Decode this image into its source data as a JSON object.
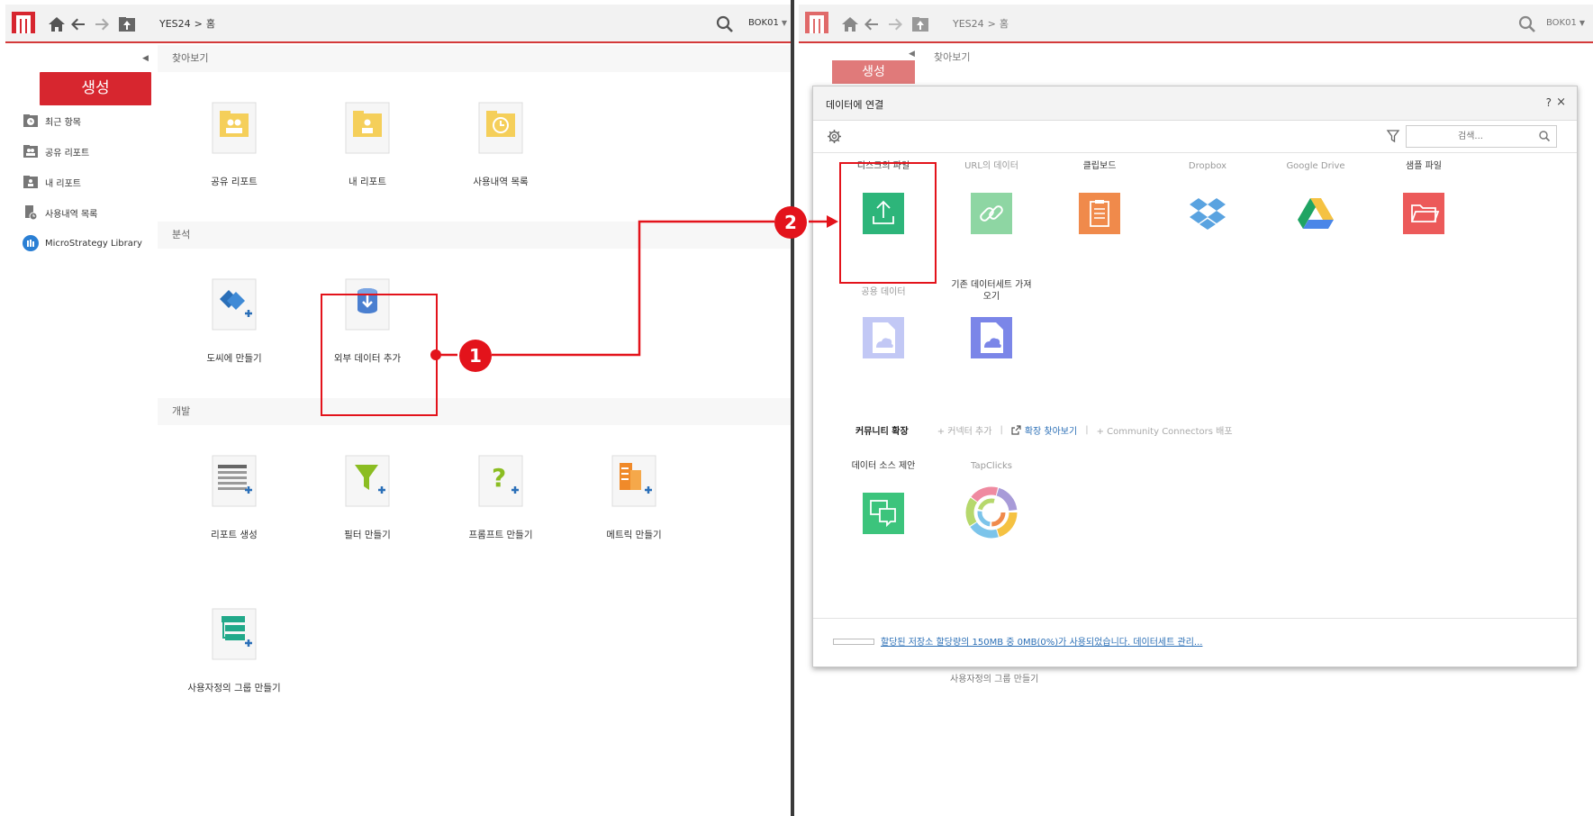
{
  "colors": {
    "accent_red": "#d7262f",
    "annotation_red": "#e3131b",
    "link_blue": "#2b6fb6"
  },
  "left": {
    "breadcrumb": [
      "YES24",
      ">",
      "홈"
    ],
    "user": "BOK01",
    "sidebar": {
      "create_label": "생성",
      "items": [
        {
          "icon": "clock-folder-icon",
          "label": "최근 항목"
        },
        {
          "icon": "shared-folder-icon",
          "label": "공유 리포트"
        },
        {
          "icon": "my-folder-icon",
          "label": "내 리포트"
        },
        {
          "icon": "history-icon",
          "label": "사용내역 목록"
        },
        {
          "icon": "library-icon",
          "label": "MicroStrategy Library"
        }
      ]
    },
    "sections": {
      "browse": {
        "header": "찾아보기",
        "tiles": [
          {
            "icon": "shared-reports-icon",
            "label": "공유 리포트"
          },
          {
            "icon": "my-reports-icon",
            "label": "내 리포트"
          },
          {
            "icon": "history-list-icon",
            "label": "사용내역 목록"
          }
        ]
      },
      "analysis": {
        "header": "분석",
        "tiles": [
          {
            "icon": "dossier-icon",
            "label": "도씨에 만들기"
          },
          {
            "icon": "add-external-data-icon",
            "label": "외부 데이터 추가"
          }
        ]
      },
      "development": {
        "header": "개발",
        "tiles": [
          {
            "icon": "report-create-icon",
            "label": "리포트 생성"
          },
          {
            "icon": "filter-create-icon",
            "label": "필터 만들기"
          },
          {
            "icon": "prompt-create-icon",
            "label": "프롬프트 만들기"
          },
          {
            "icon": "metric-create-icon",
            "label": "메트릭 만들기"
          },
          {
            "icon": "custom-group-icon",
            "label": "사용자정의 그룹 만들기"
          }
        ]
      }
    }
  },
  "right": {
    "breadcrumb": [
      "YES24",
      ">",
      "홈"
    ],
    "user": "BOK01",
    "bg": {
      "browse_header": "찾아보기",
      "create_label": "생성",
      "custom_group_label": "사용자정의 그룹 만들기"
    },
    "modal": {
      "title": "데이터에 연결",
      "help": "?",
      "close": "×",
      "search_placeholder": "검색...",
      "sources_row1": [
        {
          "label": "디스크의 파일",
          "icon": "upload-file-icon",
          "color": "#2db57a",
          "dim": false
        },
        {
          "label": "URL의 데이터",
          "icon": "link-icon",
          "color": "#8ed6a3",
          "dim": true
        },
        {
          "label": "클립보드",
          "icon": "clipboard-icon",
          "color": "#f08a4b",
          "dim": false
        },
        {
          "label": "Dropbox",
          "icon": "dropbox-icon",
          "color": "#5aa3e0",
          "dim": true
        },
        {
          "label": "Google Drive",
          "icon": "google-drive-icon",
          "color": "#f5c242",
          "dim": true
        },
        {
          "label": "샘플 파일",
          "icon": "sample-folder-icon",
          "color": "#ec5a5a",
          "dim": false
        }
      ],
      "sources_row2": [
        {
          "label": "공용 데이터",
          "icon": "public-data-icon",
          "color": "#c2c8f5",
          "dim": true
        },
        {
          "label": "기존 데이터세트 가져\n오기",
          "icon": "existing-dataset-icon",
          "color": "#7b86e8",
          "dim": false
        }
      ],
      "community": {
        "title": "커뮤니티 확장",
        "add_connector": "+ 커넥터 추가",
        "find_extensions": "확장 찾아보기",
        "deploy": "+ Community Connectors 배포"
      },
      "sources_row3": [
        {
          "label": "데이터 소스 제안",
          "icon": "suggest-source-icon",
          "color": "#3cc47c",
          "dim": false
        },
        {
          "label": "TapClicks",
          "icon": "tapclicks-icon",
          "color": "#999999",
          "dim": true
        }
      ],
      "footer_text": "할당된 저장소 할당량의 150MB 중 0MB(0%)가 사용되었습니다. 데이터세트 관리...",
      "storage_used_fraction": 0
    }
  },
  "annotations": {
    "step1": "1",
    "step2": "2"
  }
}
